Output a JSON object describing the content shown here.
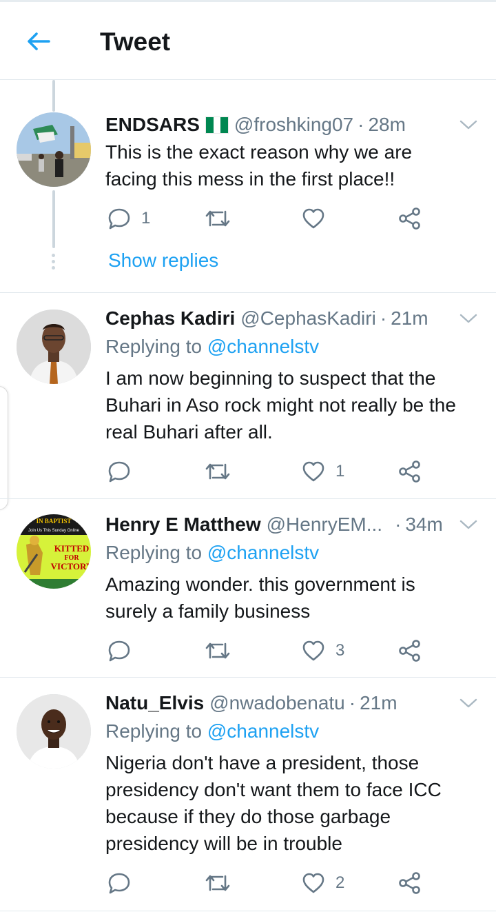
{
  "header": {
    "title": "Tweet",
    "back_icon": "back-arrow-icon"
  },
  "colors": {
    "accent": "#1da1f2",
    "muted": "#657786",
    "text": "#14171a",
    "divider": "#e1e8ed"
  },
  "tweets": [
    {
      "name": "ENDSARS",
      "flag": "nigeria-flag-icon",
      "handle": "@froshking07",
      "dot": "·",
      "time": "28m",
      "lines": [
        "This is the exact reason why we are",
        "facing this mess in the first place!!"
      ],
      "reply_count": "1",
      "retweet_count": "",
      "like_count": "",
      "show_replies": "Show replies"
    },
    {
      "name": "Cephas Kadiri",
      "handle": "@CephasKadiri",
      "dot": "·",
      "time": "21m",
      "replying_prefix": "Replying to",
      "replying_to": "@channelstv",
      "lines": [
        "I am now beginning to suspect that the",
        "Buhari in Aso rock might not really be the",
        "real Buhari after all."
      ],
      "reply_count": "",
      "retweet_count": "",
      "like_count": "1"
    },
    {
      "name": "Henry E Matthew",
      "handle": "@HenryEM...",
      "dot": "·",
      "time": "34m",
      "replying_prefix": "Replying to",
      "replying_to": "@channelstv",
      "lines": [
        "Amazing wonder. this government is",
        "surely a family business"
      ],
      "reply_count": "",
      "retweet_count": "",
      "like_count": "3",
      "avatar_text": {
        "top": "IN BAPTIST",
        "sub": "Join Us This Sunday Online",
        "kitted": "KITTED",
        "for": "FOR",
        "victory": "VICTORY"
      }
    },
    {
      "name": "Natu_Elvis",
      "handle": "@nwadobenatu",
      "dot": "·",
      "time": "21m",
      "replying_prefix": "Replying to",
      "replying_to": "@channelstv",
      "lines": [
        "Nigeria don't have a president, those",
        "presidency don't want them to face ICC",
        "because if they do those garbage",
        "presidency will be in trouble"
      ],
      "reply_count": "",
      "retweet_count": "",
      "like_count": "2"
    }
  ]
}
